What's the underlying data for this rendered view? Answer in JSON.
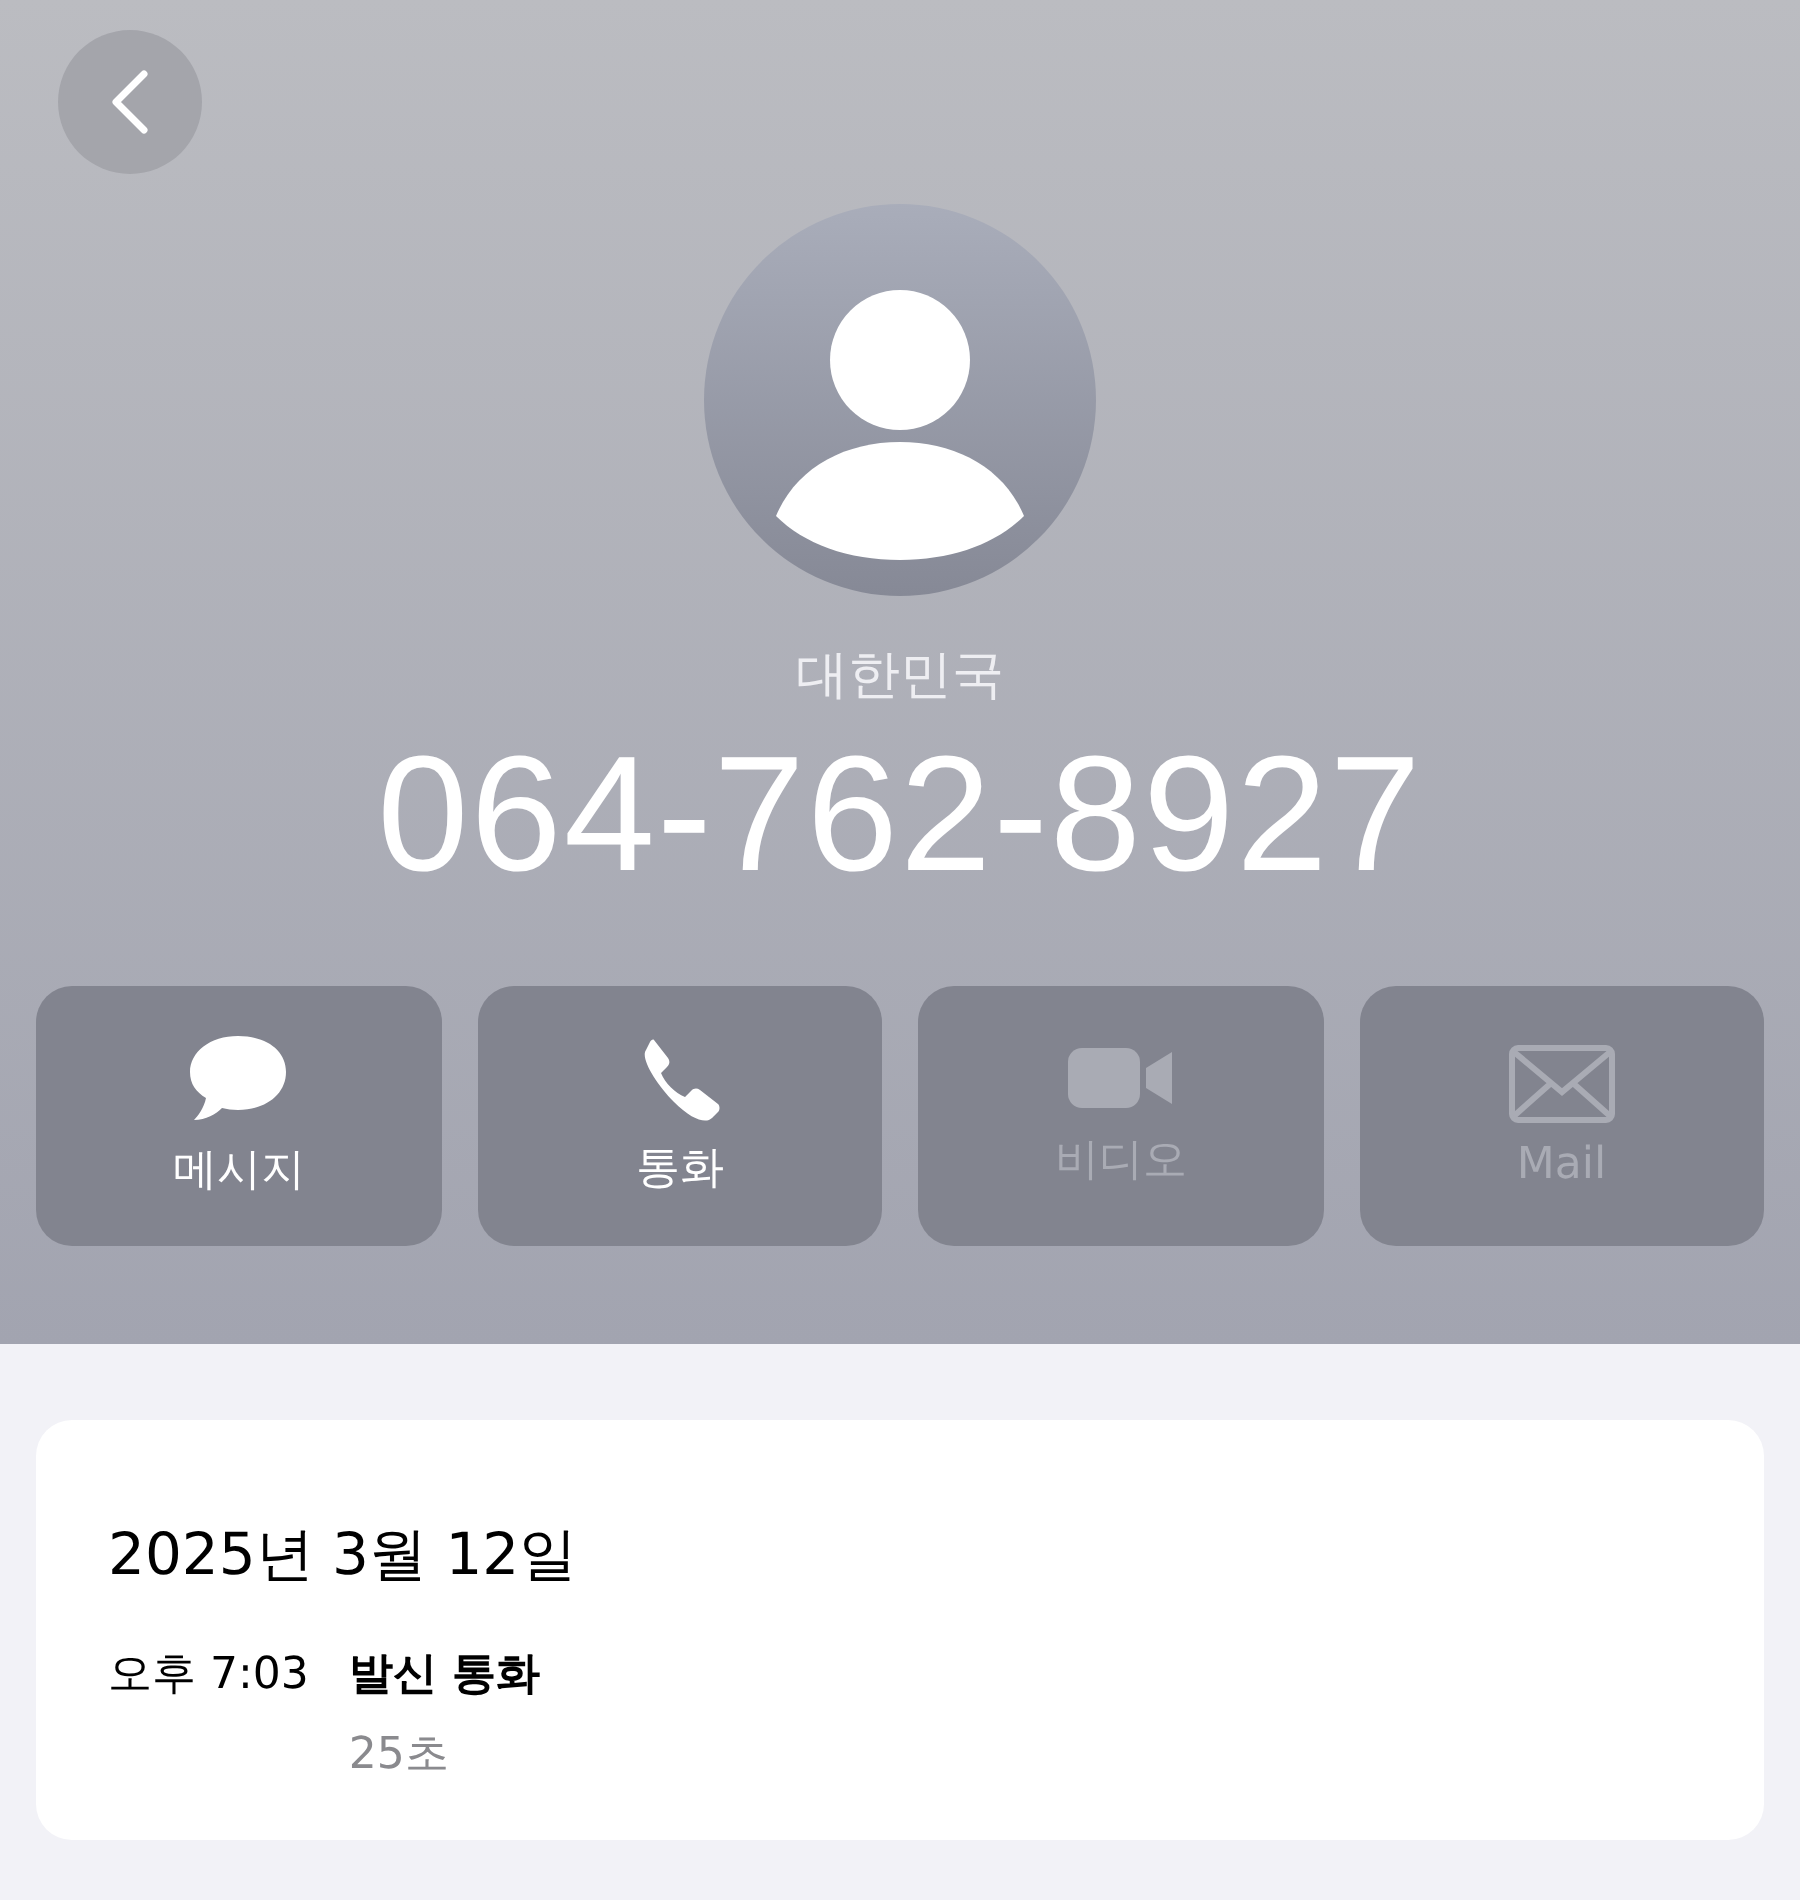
{
  "contact": {
    "country": "대한민국",
    "phone": "064-762-8927"
  },
  "actions": [
    {
      "kind": "message",
      "label": "메시지",
      "disabled": false
    },
    {
      "kind": "call",
      "label": "통화",
      "disabled": false
    },
    {
      "kind": "video",
      "label": "비디오",
      "disabled": true
    },
    {
      "kind": "mail",
      "label": "Mail",
      "disabled": true
    }
  ],
  "call_log": {
    "date": "2025년 3월 12일",
    "entries": [
      {
        "time": "오후 7:03",
        "type": "발신 통화",
        "duration": "25초"
      }
    ]
  }
}
